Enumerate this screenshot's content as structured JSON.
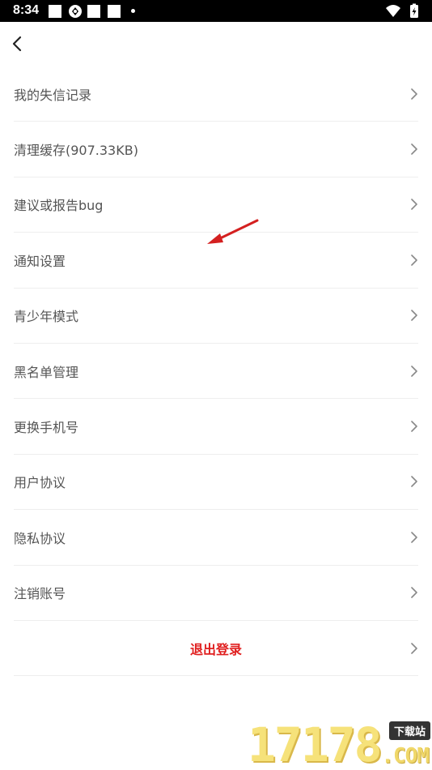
{
  "status_bar": {
    "time": "8:34",
    "icons": [
      "notification-square-icon",
      "sync-icon",
      "notification-square-icon",
      "notification-square-icon",
      "dot-icon",
      "wifi-icon",
      "battery-charging-icon"
    ]
  },
  "header": {
    "back_icon": "chevron-left-icon"
  },
  "menu": {
    "items": [
      {
        "label": "我的失信记录"
      },
      {
        "label": "清理缓存(907.33KB)"
      },
      {
        "label": "建议或报告bug"
      },
      {
        "label": "通知设置"
      },
      {
        "label": "青少年模式"
      },
      {
        "label": "黑名单管理"
      },
      {
        "label": "更换手机号"
      },
      {
        "label": "用户协议"
      },
      {
        "label": "隐私协议"
      },
      {
        "label": "注销账号"
      }
    ],
    "logout_label": "退出登录",
    "chevron_icon": "chevron-right-icon"
  },
  "watermark": {
    "number": "17178",
    "badge": "下载站",
    "domain": ".COM"
  },
  "colors": {
    "logout": "#e02020",
    "label": "#555555",
    "divider": "#eeeeee",
    "annotation_arrow": "#d42020"
  }
}
